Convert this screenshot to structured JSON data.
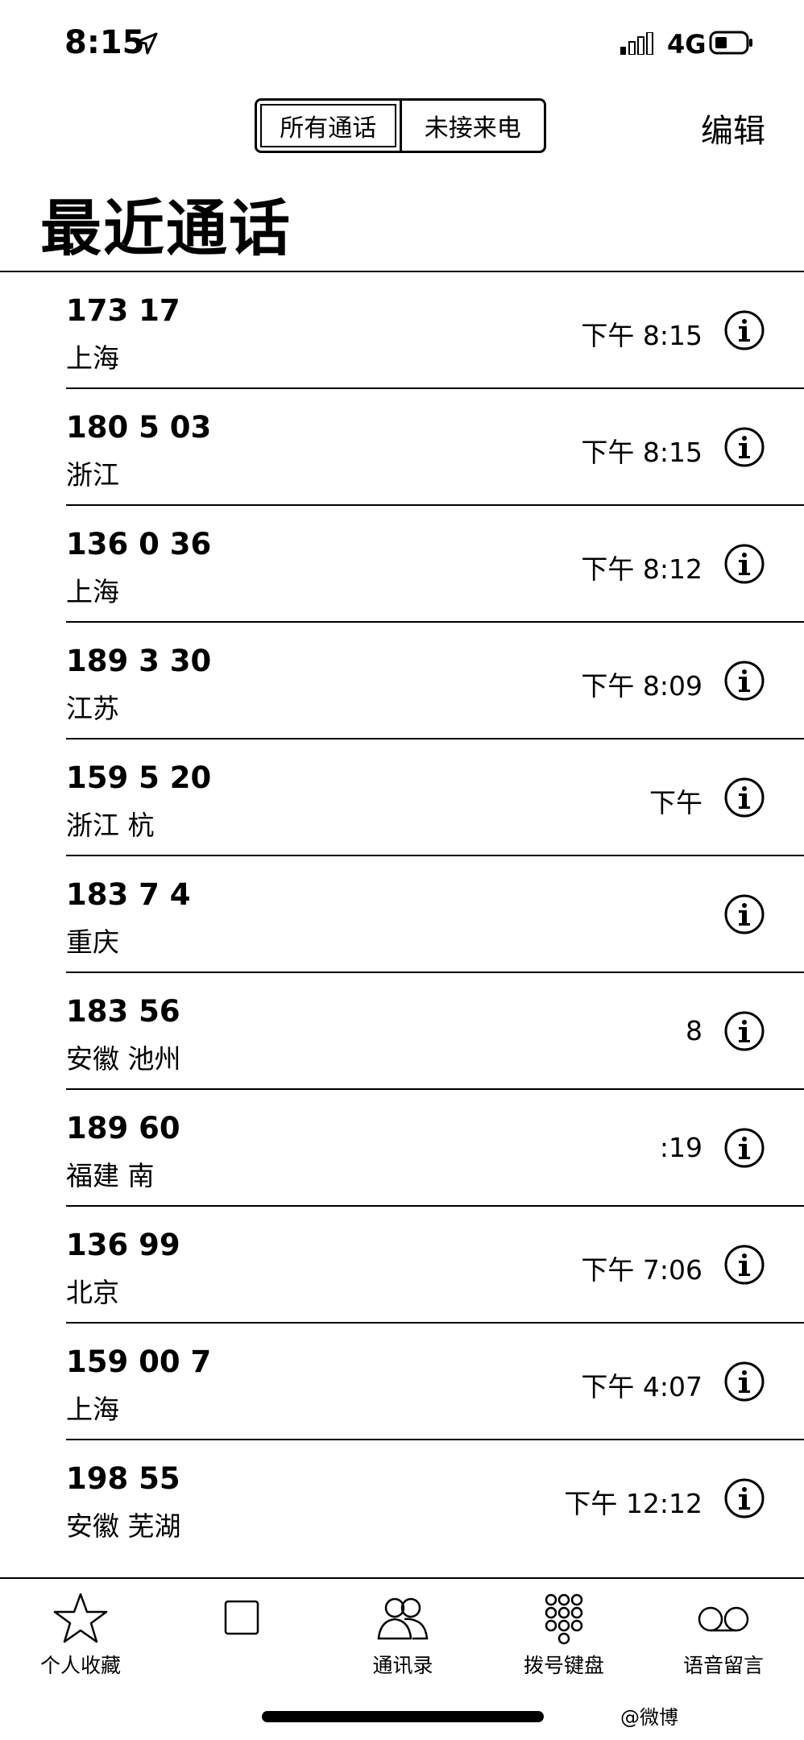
{
  "status_bar": {
    "time": "8:15",
    "network": "4G"
  },
  "header": {
    "segments": [
      "所有通话",
      "未接来电"
    ],
    "edit_label": "编辑",
    "title": "最近通话"
  },
  "calls": [
    {
      "number": "173 17",
      "location": "上海",
      "time": "下午 8:15"
    },
    {
      "number": "180 5   03",
      "location": "浙江",
      "time": "下午 8:15"
    },
    {
      "number": "136 0   36",
      "location": "上海",
      "time": "下午 8:12"
    },
    {
      "number": "189 3   30",
      "location": "江苏",
      "time": "下午 8:09"
    },
    {
      "number": "159 5   20",
      "location": "浙江 杭",
      "time": "下午"
    },
    {
      "number": "183 7   4",
      "location": "重庆",
      "time": ""
    },
    {
      "number": "183 56",
      "location": "安徽 池州",
      "time": "8"
    },
    {
      "number": "189 60",
      "location": "福建 南",
      "time": ":19"
    },
    {
      "number": "136 99",
      "location": "北京",
      "time": "下午 7:06"
    },
    {
      "number": "159 00   7",
      "location": "上海",
      "time": "下午 4:07"
    },
    {
      "number": "198 55",
      "location": "安徽 芜湖",
      "time": "下午 12:12"
    }
  ],
  "tabbar": {
    "favorites": "个人收藏",
    "recents": "",
    "contacts": "通讯录",
    "keypad": "拨号键盘",
    "voicemail": "语音留言"
  },
  "watermark": "@微博"
}
